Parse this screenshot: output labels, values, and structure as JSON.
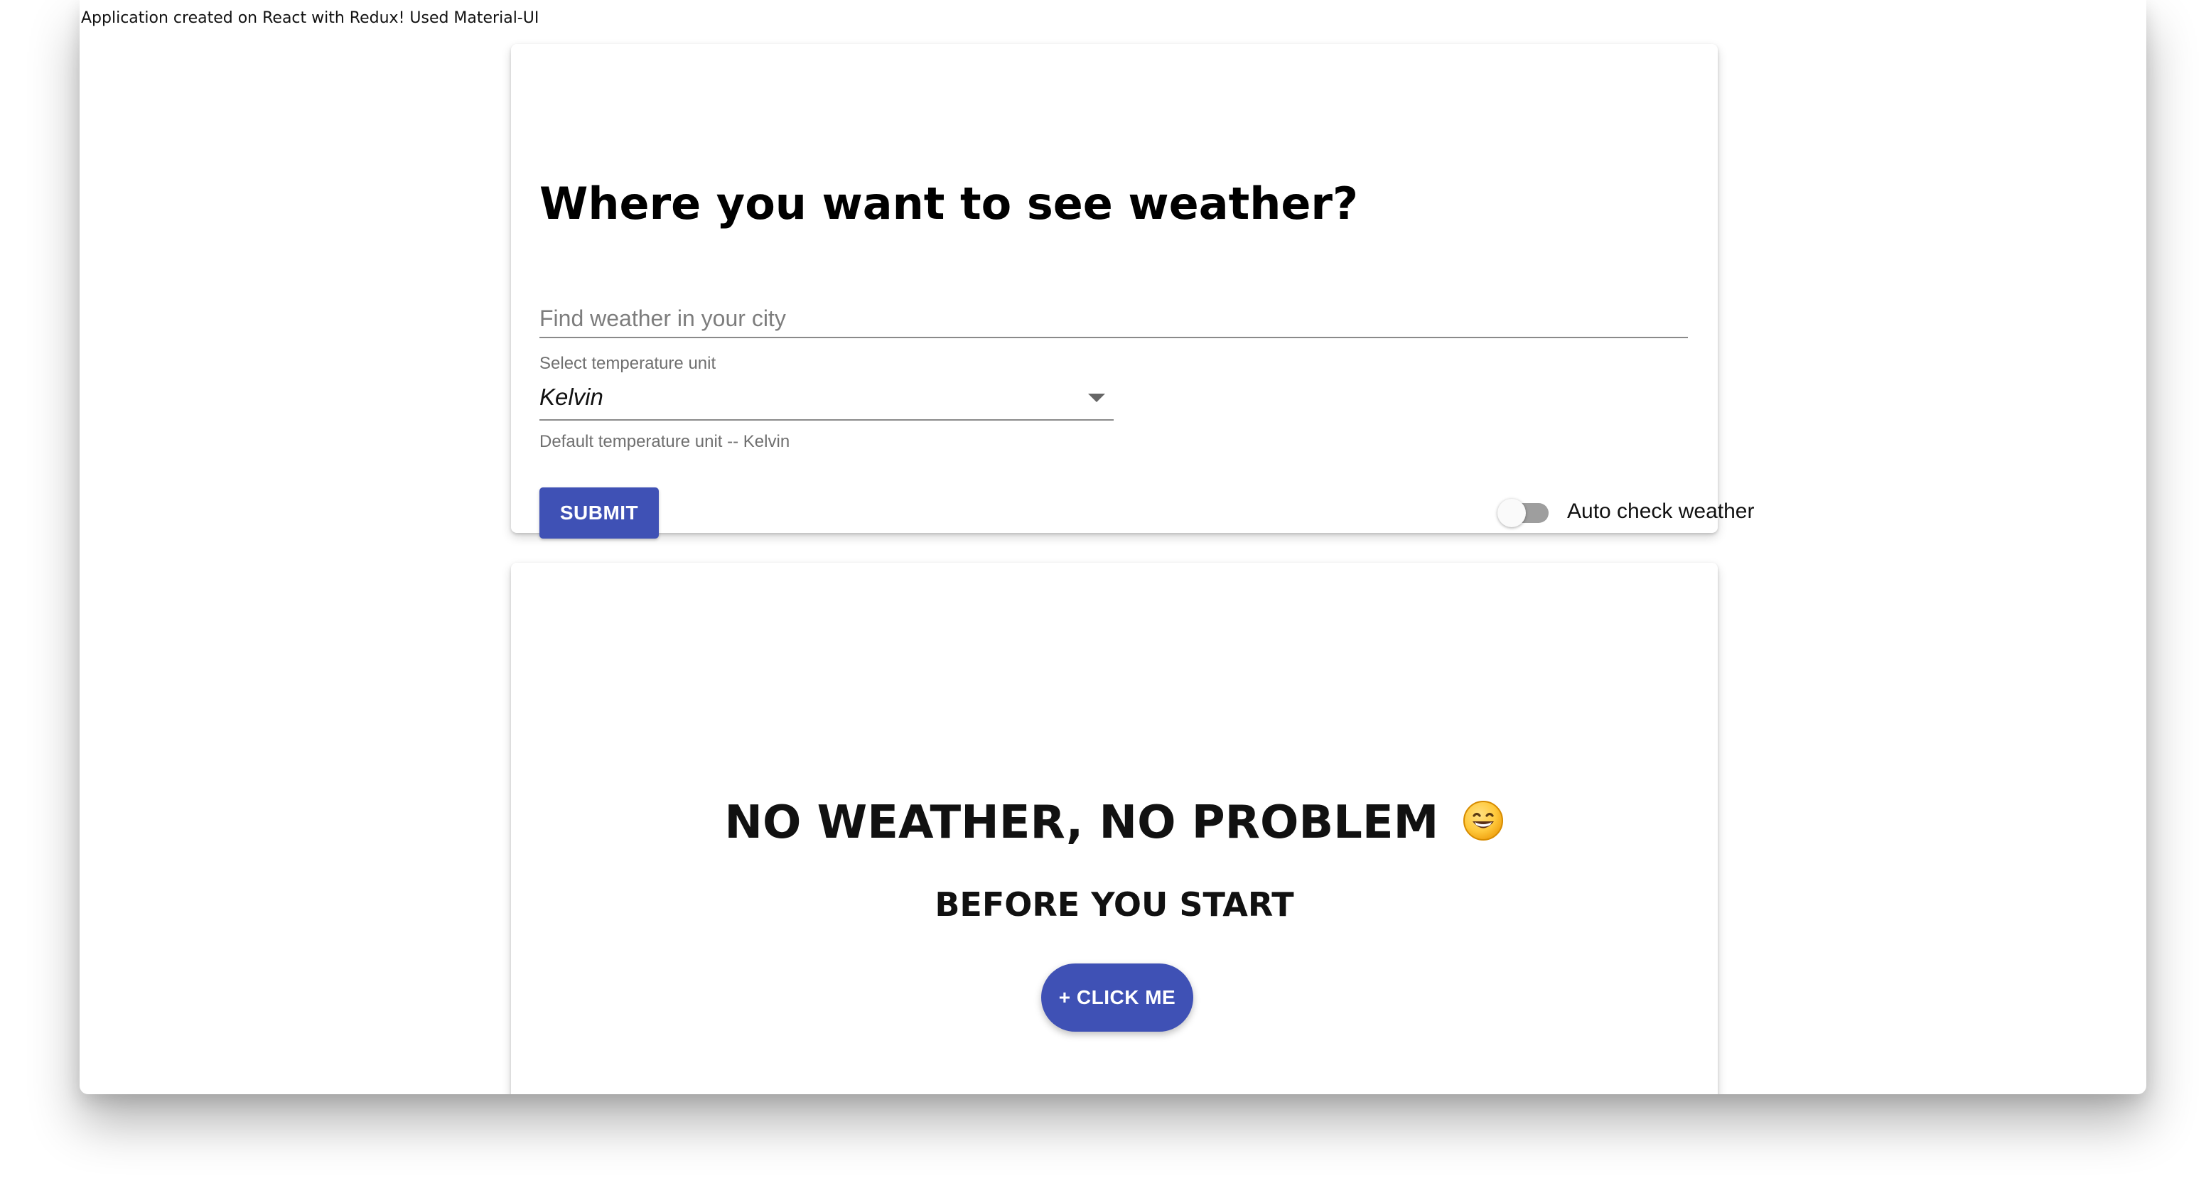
{
  "app": {
    "footer_note": "Application created on React with Redux! Used Material-UI"
  },
  "search_card": {
    "title": "Where you want to see weather?",
    "city_input": {
      "value": "",
      "placeholder": "Find weather in your city"
    },
    "temperature_unit": {
      "label": "Select temperature unit",
      "selected": "Kelvin",
      "helper_text": "Default temperature unit -- Kelvin",
      "dropdown_icon": "caret-down-icon"
    },
    "submit_label": "SUBMIT",
    "auto_check": {
      "label": "Auto check weather",
      "enabled": false
    }
  },
  "empty_state": {
    "title": "NO WEATHER, NO PROBLEM",
    "emoji_icon": "grinning-face-icon",
    "subtitle": "BEFORE YOU START",
    "button_label": "+ CLICK ME"
  },
  "colors": {
    "primary": "#3f51b5",
    "toggle_track": "#9e9e9e",
    "helper_text": "#6f6f6f"
  }
}
